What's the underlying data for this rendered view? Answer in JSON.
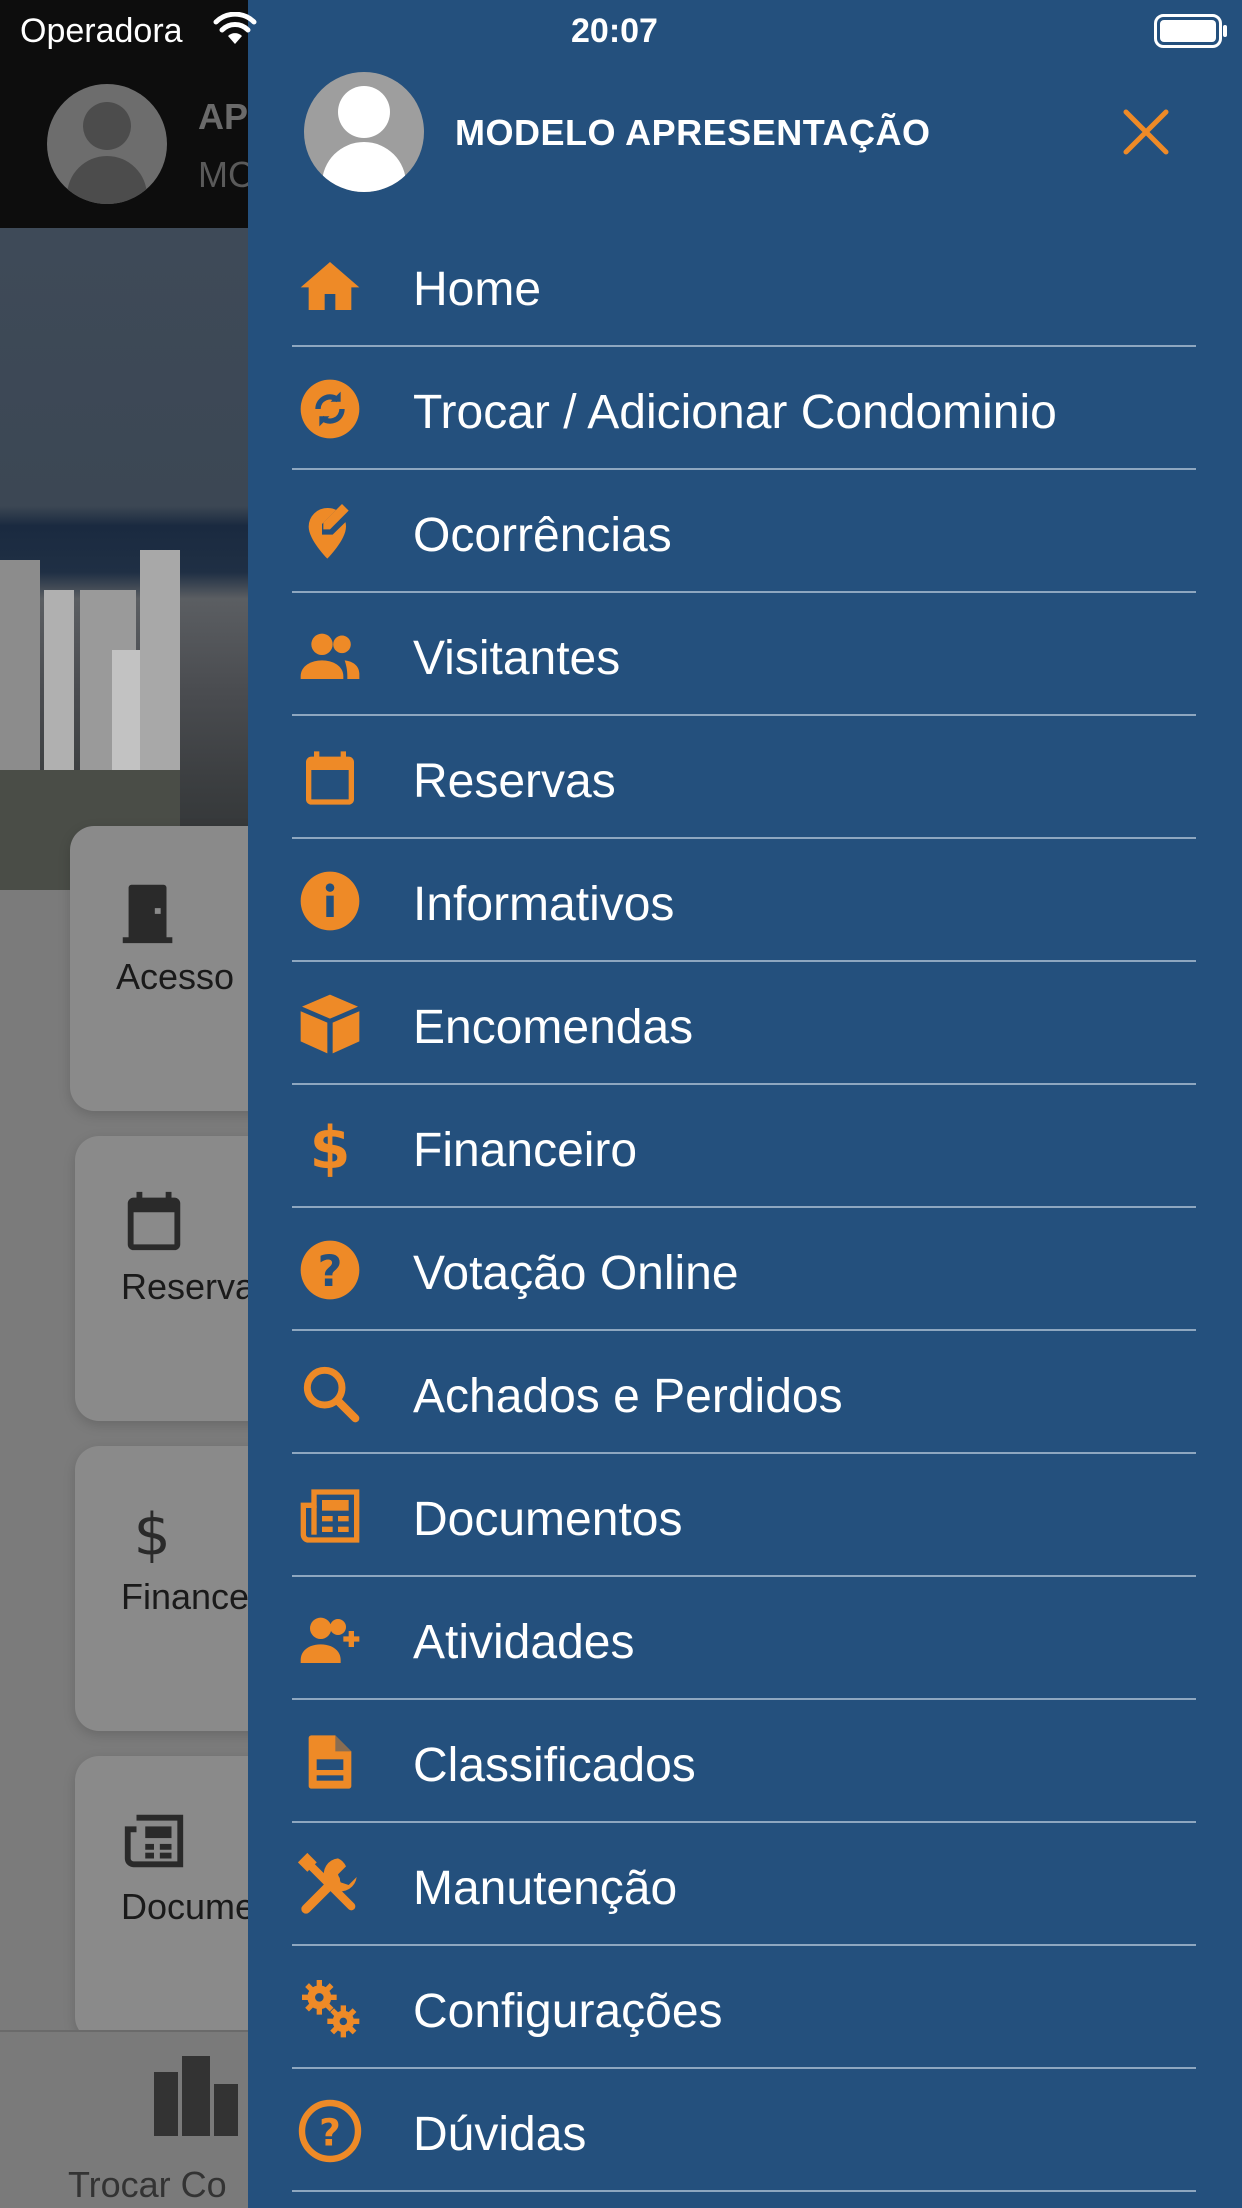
{
  "status_bar": {
    "carrier": "Operadora",
    "time": "20:07"
  },
  "background": {
    "header_title": "AP",
    "header_subtitle": "MC",
    "cards": [
      {
        "label": "Acesso",
        "icon": "door-icon"
      },
      {
        "label": "Reserva",
        "icon": "calendar-icon"
      },
      {
        "label": "Finance",
        "icon": "dollar-icon"
      },
      {
        "label": "Docume",
        "icon": "newspaper-icon"
      }
    ],
    "bottom_bar_label": "Trocar Co"
  },
  "drawer": {
    "user_name": "MODELO APRESENTAÇÃO",
    "items": [
      {
        "label": "Home",
        "icon": "home-icon"
      },
      {
        "label": "Trocar / Adicionar Condominio",
        "icon": "sync-icon"
      },
      {
        "label": "Ocorrências",
        "icon": "map-marker-edit-icon"
      },
      {
        "label": "Visitantes",
        "icon": "users-icon"
      },
      {
        "label": "Reservas",
        "icon": "calendar-icon"
      },
      {
        "label": "Informativos",
        "icon": "info-icon"
      },
      {
        "label": "Encomendas",
        "icon": "package-icon"
      },
      {
        "label": "Financeiro",
        "icon": "dollar-icon"
      },
      {
        "label": "Votação Online",
        "icon": "question-circle-icon"
      },
      {
        "label": "Achados e Perdidos",
        "icon": "search-icon"
      },
      {
        "label": "Documentos",
        "icon": "newspaper-icon"
      },
      {
        "label": "Atividades",
        "icon": "user-plus-icon"
      },
      {
        "label": "Classificados",
        "icon": "document-icon"
      },
      {
        "label": "Manutenção",
        "icon": "tools-icon"
      },
      {
        "label": "Configurações",
        "icon": "gears-icon"
      },
      {
        "label": "Dúvidas",
        "icon": "help-circle-icon"
      }
    ]
  },
  "colors": {
    "drawer_background": "#24507d",
    "accent": "#ee8a27",
    "divider": "#8ea7c0",
    "text": "#ffffff"
  }
}
